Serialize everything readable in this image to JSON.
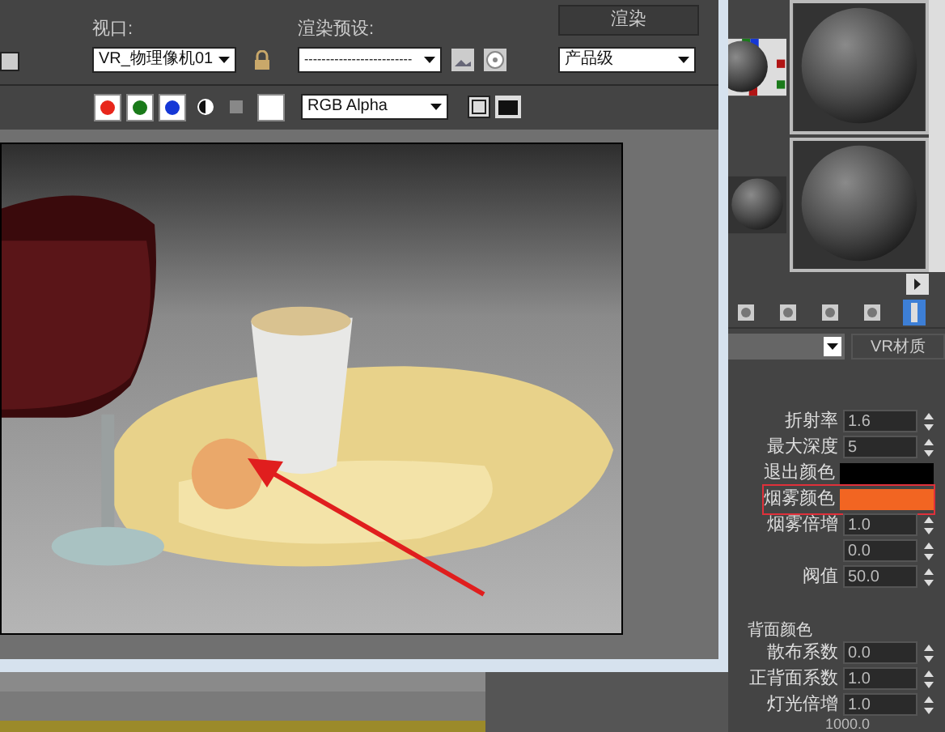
{
  "render_window": {
    "viewport": {
      "label": "视口:",
      "value": "VR_物理像机01"
    },
    "preset": {
      "label": "渲染预设:",
      "value": "-------------------------"
    },
    "render_button": "渲染",
    "quality": "产品级",
    "channels": [
      {
        "color": "#e8261b"
      },
      {
        "color": "#1a7a1a"
      },
      {
        "color": "#1537d6"
      }
    ],
    "display_mode": "RGB Alpha"
  },
  "material_editor": {
    "material_type": "VR材质",
    "params": [
      {
        "kind": "spinner",
        "label": "折射率",
        "value": "1.6"
      },
      {
        "kind": "spinner",
        "label": "最大深度",
        "value": "5"
      },
      {
        "kind": "swatch",
        "label": "退出颜色",
        "color": "#000000",
        "highlighted": false
      },
      {
        "kind": "swatch",
        "label": "烟雾颜色",
        "color": "#f26522",
        "highlighted": true
      },
      {
        "kind": "spinner",
        "label": "烟雾倍增",
        "value": "1.0"
      },
      {
        "kind": "spinner",
        "value": "0.0"
      },
      {
        "kind": "spinner",
        "label": "阀值",
        "value": "50.0"
      }
    ],
    "params2": [
      {
        "kind": "spinner",
        "label": "散布系数",
        "value": "0.0"
      },
      {
        "kind": "spinner",
        "label": "正背面系数",
        "value": "1.0"
      },
      {
        "kind": "spinner",
        "label": "灯光倍增",
        "value": "1.0"
      }
    ]
  },
  "back_color_label": "背面颜色",
  "thickness": "1000.0"
}
